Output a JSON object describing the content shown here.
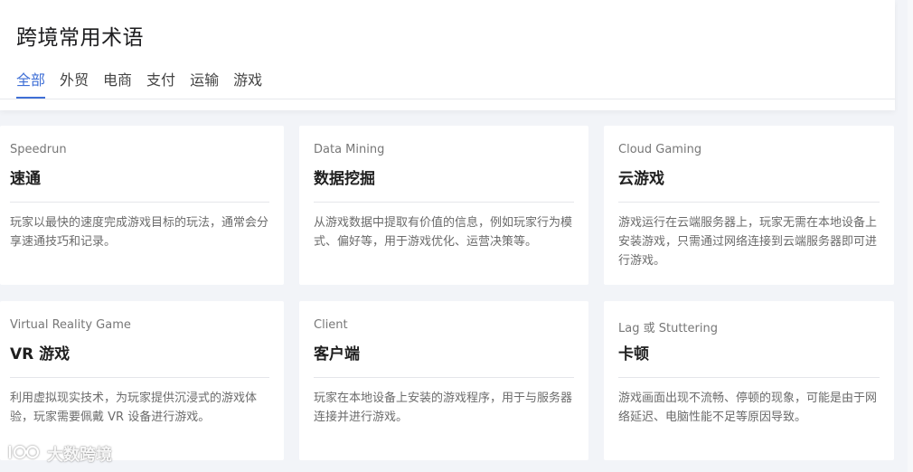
{
  "page": {
    "title": "跨境常用术语"
  },
  "tabs": [
    {
      "label": "全部",
      "active": true
    },
    {
      "label": "外贸",
      "active": false
    },
    {
      "label": "电商",
      "active": false
    },
    {
      "label": "支付",
      "active": false
    },
    {
      "label": "运输",
      "active": false
    },
    {
      "label": "游戏",
      "active": false
    }
  ],
  "cards": [
    {
      "en": "Speedrun",
      "cn": "速通",
      "desc": "玩家以最快的速度完成游戏目标的玩法，通常会分享速通技巧和记录。"
    },
    {
      "en": "Data Mining",
      "cn": "数据挖掘",
      "desc": "从游戏数据中提取有价值的信息，例如玩家行为模式、偏好等，用于游戏优化、运营决策等。"
    },
    {
      "en": "Cloud Gaming",
      "cn": "云游戏",
      "desc": "游戏运行在云端服务器上，玩家无需在本地设备上安装游戏，只需通过网络连接到云端服务器即可进行游戏。"
    },
    {
      "en": "Virtual Reality Game",
      "cn": "VR 游戏",
      "desc": "利用虚拟现实技术，为玩家提供沉浸式的游戏体验，玩家需要佩戴 VR 设备进行游戏。"
    },
    {
      "en": "Client",
      "cn": "客户端",
      "desc": "玩家在本地设备上安装的游戏程序，用于与服务器连接并进行游戏。"
    },
    {
      "en": "Lag 或 Stuttering",
      "cn": "卡顿",
      "desc": "游戏画面出现不流畅、停顿的现象，可能是由于网络延迟、电脑性能不足等原因导致。"
    }
  ],
  "watermark": {
    "text": "大数跨境",
    "icon": "logo-icon"
  },
  "colors": {
    "accent": "#3f6fd6",
    "background": "#f2f4f8"
  }
}
